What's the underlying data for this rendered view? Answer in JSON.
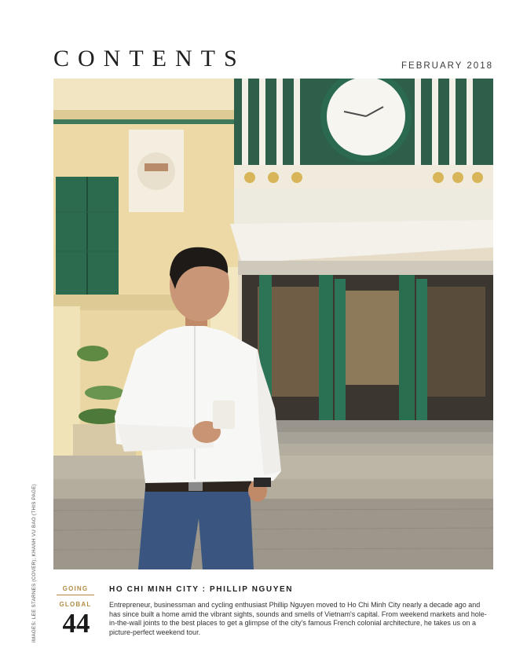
{
  "header": {
    "title": "CONTENTS",
    "issue_date": "FEBRUARY 2018"
  },
  "photo": {
    "description_icon": "portrait-photo"
  },
  "credit": "IMAGES: LEE STARNES (COVER); KHANH VU BAO (THIS PAGE)",
  "article": {
    "section_line1": "GOING",
    "section_line2": "GLOBAL",
    "page_number": "44",
    "headline": "HO CHI MINH CITY : PHILLIP NGUYEN",
    "summary": "Entrepreneur, businessman and cycling enthusiast Phillip Nguyen moved to Ho Chi Minh City nearly a decade ago and has since built a home amid the vibrant sights, sounds and smells of Vietnam's capital. From weekend markets and hole-in-the-wall joints to the best places to get a glimpse of the city's famous French colonial architecture, he takes us on a picture-perfect weekend tour."
  },
  "colors": {
    "accent_gold": "#b38d45",
    "building_yellow": "#ecd9a6",
    "shutter_green": "#2c6b4e"
  }
}
